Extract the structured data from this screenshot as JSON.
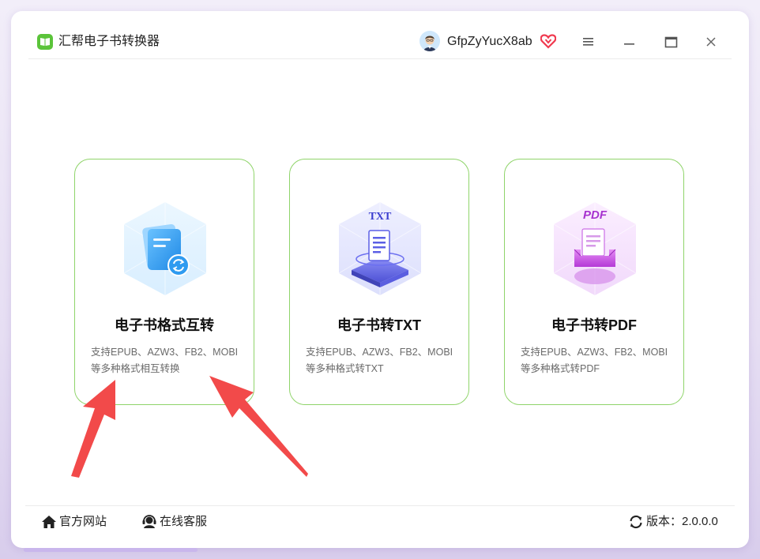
{
  "app": {
    "title": "汇帮电子书转换器",
    "username": "GfpZyYucX8ab"
  },
  "icons": {
    "logo": "book-logo-icon",
    "avatar": "user-avatar",
    "vip": "vip-heart-icon",
    "menu": "hamburger-menu-icon",
    "minimize": "minimize-icon",
    "maximize": "maximize-icon",
    "close": "close-icon",
    "home": "home-icon",
    "support": "headset-icon",
    "refresh": "refresh-icon"
  },
  "cards": [
    {
      "title": "电子书格式互转",
      "desc_line1": "支持EPUB、AZW3、FB2、MOBI",
      "desc_line2": "等多种格式相互转换"
    },
    {
      "title": "电子书转TXT",
      "badge": "TXT",
      "desc_line1": "支持EPUB、AZW3、FB2、MOBI",
      "desc_line2": "等多种格式转TXT"
    },
    {
      "title": "电子书转PDF",
      "badge": "PDF",
      "desc_line1": "支持EPUB、AZW3、FB2、MOBI",
      "desc_line2": "等多种格式转PDF"
    }
  ],
  "footer": {
    "official_site": "官方网站",
    "online_service": "在线客服",
    "version": "版本：2.0.0.0"
  },
  "colors": {
    "accent_green": "#5bc43a",
    "card_border": "#8fd46a",
    "arrow_red": "#f24a4a",
    "scrollbar": "#c9b6ec"
  }
}
